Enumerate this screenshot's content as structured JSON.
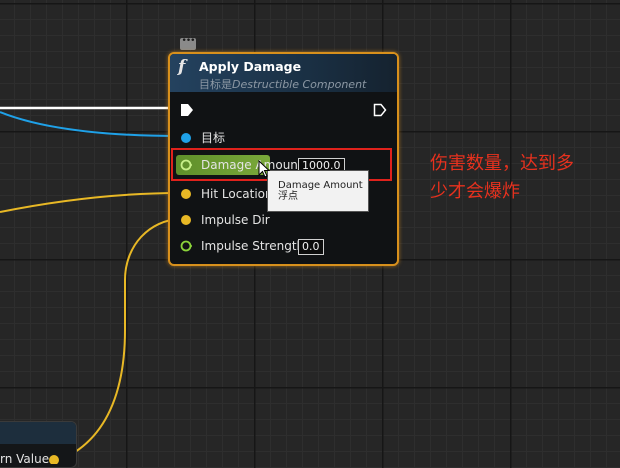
{
  "node": {
    "title": "Apply Damage",
    "subtitle_prefix": "目标是",
    "subtitle_target": "Destructible Component",
    "function_icon": "f",
    "comment_icon": "comment-bubble-icon",
    "pins": {
      "exec_in": "exec-input-pin",
      "exec_out": "exec-output-pin",
      "target_label": "目标",
      "damage_amount_label": "Damage Amount",
      "damage_amount_value": "1000.0",
      "hit_location_label": "Hit Location",
      "impulse_dir_label": "Impulse Dir",
      "impulse_strength_label": "Impulse Strength",
      "impulse_strength_value": "0.0"
    }
  },
  "tooltip": {
    "line1": "Damage Amount",
    "line2": "浮点"
  },
  "annotation": {
    "line1": "伤害数量，达到多",
    "line2": "少才会爆炸",
    "color": "#e6311e"
  },
  "return_node": {
    "label": "rn Value"
  },
  "colors": {
    "exec_wire": "#ffffff",
    "object_wire": "#1fa1e8",
    "vector_wire": "#e8b825",
    "float_pin": "#8bd33a",
    "node_border": "#d8901c"
  }
}
